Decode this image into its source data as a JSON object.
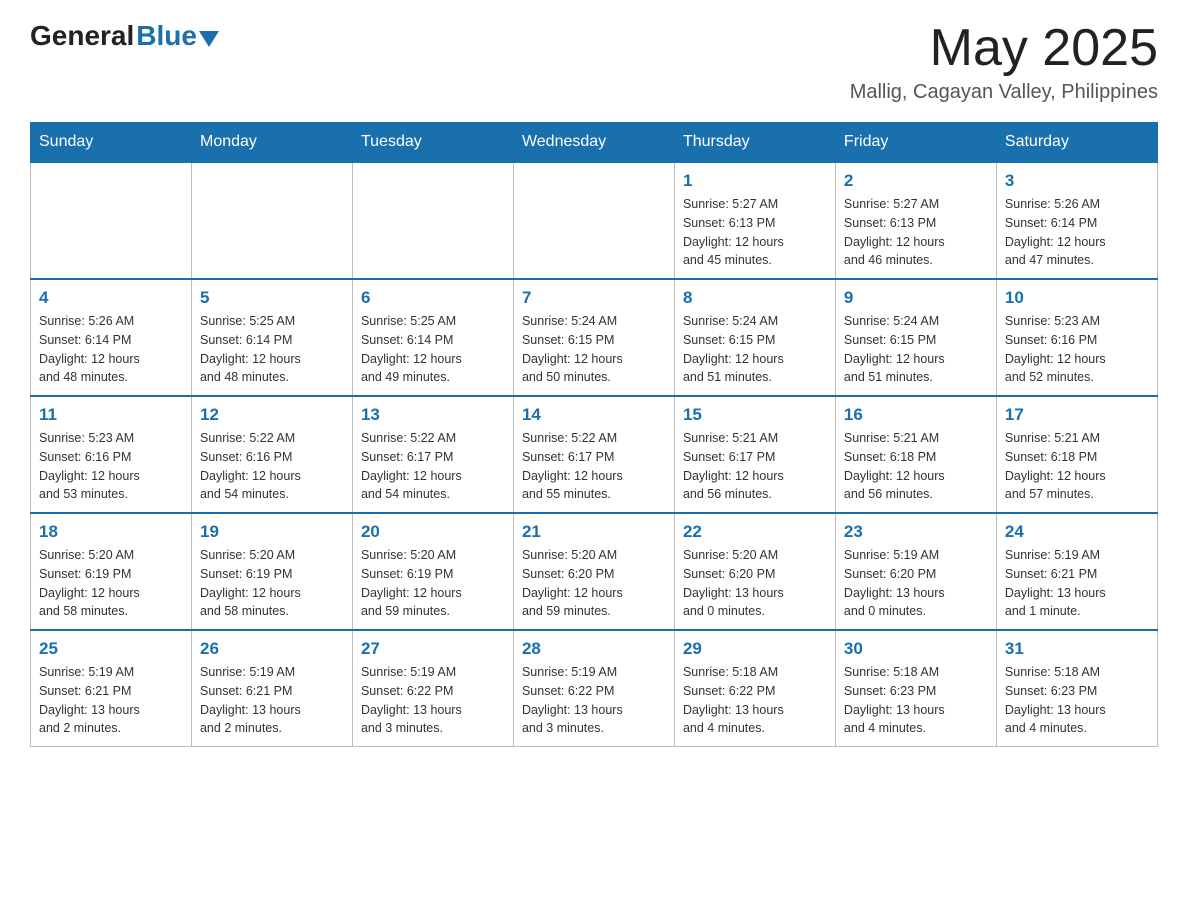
{
  "header": {
    "logo_general": "General",
    "logo_blue": "Blue",
    "month_title": "May 2025",
    "location": "Mallig, Cagayan Valley, Philippines"
  },
  "days_of_week": [
    "Sunday",
    "Monday",
    "Tuesday",
    "Wednesday",
    "Thursday",
    "Friday",
    "Saturday"
  ],
  "weeks": [
    {
      "days": [
        {
          "number": "",
          "info": ""
        },
        {
          "number": "",
          "info": ""
        },
        {
          "number": "",
          "info": ""
        },
        {
          "number": "",
          "info": ""
        },
        {
          "number": "1",
          "info": "Sunrise: 5:27 AM\nSunset: 6:13 PM\nDaylight: 12 hours\nand 45 minutes."
        },
        {
          "number": "2",
          "info": "Sunrise: 5:27 AM\nSunset: 6:13 PM\nDaylight: 12 hours\nand 46 minutes."
        },
        {
          "number": "3",
          "info": "Sunrise: 5:26 AM\nSunset: 6:14 PM\nDaylight: 12 hours\nand 47 minutes."
        }
      ]
    },
    {
      "days": [
        {
          "number": "4",
          "info": "Sunrise: 5:26 AM\nSunset: 6:14 PM\nDaylight: 12 hours\nand 48 minutes."
        },
        {
          "number": "5",
          "info": "Sunrise: 5:25 AM\nSunset: 6:14 PM\nDaylight: 12 hours\nand 48 minutes."
        },
        {
          "number": "6",
          "info": "Sunrise: 5:25 AM\nSunset: 6:14 PM\nDaylight: 12 hours\nand 49 minutes."
        },
        {
          "number": "7",
          "info": "Sunrise: 5:24 AM\nSunset: 6:15 PM\nDaylight: 12 hours\nand 50 minutes."
        },
        {
          "number": "8",
          "info": "Sunrise: 5:24 AM\nSunset: 6:15 PM\nDaylight: 12 hours\nand 51 minutes."
        },
        {
          "number": "9",
          "info": "Sunrise: 5:24 AM\nSunset: 6:15 PM\nDaylight: 12 hours\nand 51 minutes."
        },
        {
          "number": "10",
          "info": "Sunrise: 5:23 AM\nSunset: 6:16 PM\nDaylight: 12 hours\nand 52 minutes."
        }
      ]
    },
    {
      "days": [
        {
          "number": "11",
          "info": "Sunrise: 5:23 AM\nSunset: 6:16 PM\nDaylight: 12 hours\nand 53 minutes."
        },
        {
          "number": "12",
          "info": "Sunrise: 5:22 AM\nSunset: 6:16 PM\nDaylight: 12 hours\nand 54 minutes."
        },
        {
          "number": "13",
          "info": "Sunrise: 5:22 AM\nSunset: 6:17 PM\nDaylight: 12 hours\nand 54 minutes."
        },
        {
          "number": "14",
          "info": "Sunrise: 5:22 AM\nSunset: 6:17 PM\nDaylight: 12 hours\nand 55 minutes."
        },
        {
          "number": "15",
          "info": "Sunrise: 5:21 AM\nSunset: 6:17 PM\nDaylight: 12 hours\nand 56 minutes."
        },
        {
          "number": "16",
          "info": "Sunrise: 5:21 AM\nSunset: 6:18 PM\nDaylight: 12 hours\nand 56 minutes."
        },
        {
          "number": "17",
          "info": "Sunrise: 5:21 AM\nSunset: 6:18 PM\nDaylight: 12 hours\nand 57 minutes."
        }
      ]
    },
    {
      "days": [
        {
          "number": "18",
          "info": "Sunrise: 5:20 AM\nSunset: 6:19 PM\nDaylight: 12 hours\nand 58 minutes."
        },
        {
          "number": "19",
          "info": "Sunrise: 5:20 AM\nSunset: 6:19 PM\nDaylight: 12 hours\nand 58 minutes."
        },
        {
          "number": "20",
          "info": "Sunrise: 5:20 AM\nSunset: 6:19 PM\nDaylight: 12 hours\nand 59 minutes."
        },
        {
          "number": "21",
          "info": "Sunrise: 5:20 AM\nSunset: 6:20 PM\nDaylight: 12 hours\nand 59 minutes."
        },
        {
          "number": "22",
          "info": "Sunrise: 5:20 AM\nSunset: 6:20 PM\nDaylight: 13 hours\nand 0 minutes."
        },
        {
          "number": "23",
          "info": "Sunrise: 5:19 AM\nSunset: 6:20 PM\nDaylight: 13 hours\nand 0 minutes."
        },
        {
          "number": "24",
          "info": "Sunrise: 5:19 AM\nSunset: 6:21 PM\nDaylight: 13 hours\nand 1 minute."
        }
      ]
    },
    {
      "days": [
        {
          "number": "25",
          "info": "Sunrise: 5:19 AM\nSunset: 6:21 PM\nDaylight: 13 hours\nand 2 minutes."
        },
        {
          "number": "26",
          "info": "Sunrise: 5:19 AM\nSunset: 6:21 PM\nDaylight: 13 hours\nand 2 minutes."
        },
        {
          "number": "27",
          "info": "Sunrise: 5:19 AM\nSunset: 6:22 PM\nDaylight: 13 hours\nand 3 minutes."
        },
        {
          "number": "28",
          "info": "Sunrise: 5:19 AM\nSunset: 6:22 PM\nDaylight: 13 hours\nand 3 minutes."
        },
        {
          "number": "29",
          "info": "Sunrise: 5:18 AM\nSunset: 6:22 PM\nDaylight: 13 hours\nand 4 minutes."
        },
        {
          "number": "30",
          "info": "Sunrise: 5:18 AM\nSunset: 6:23 PM\nDaylight: 13 hours\nand 4 minutes."
        },
        {
          "number": "31",
          "info": "Sunrise: 5:18 AM\nSunset: 6:23 PM\nDaylight: 13 hours\nand 4 minutes."
        }
      ]
    }
  ]
}
